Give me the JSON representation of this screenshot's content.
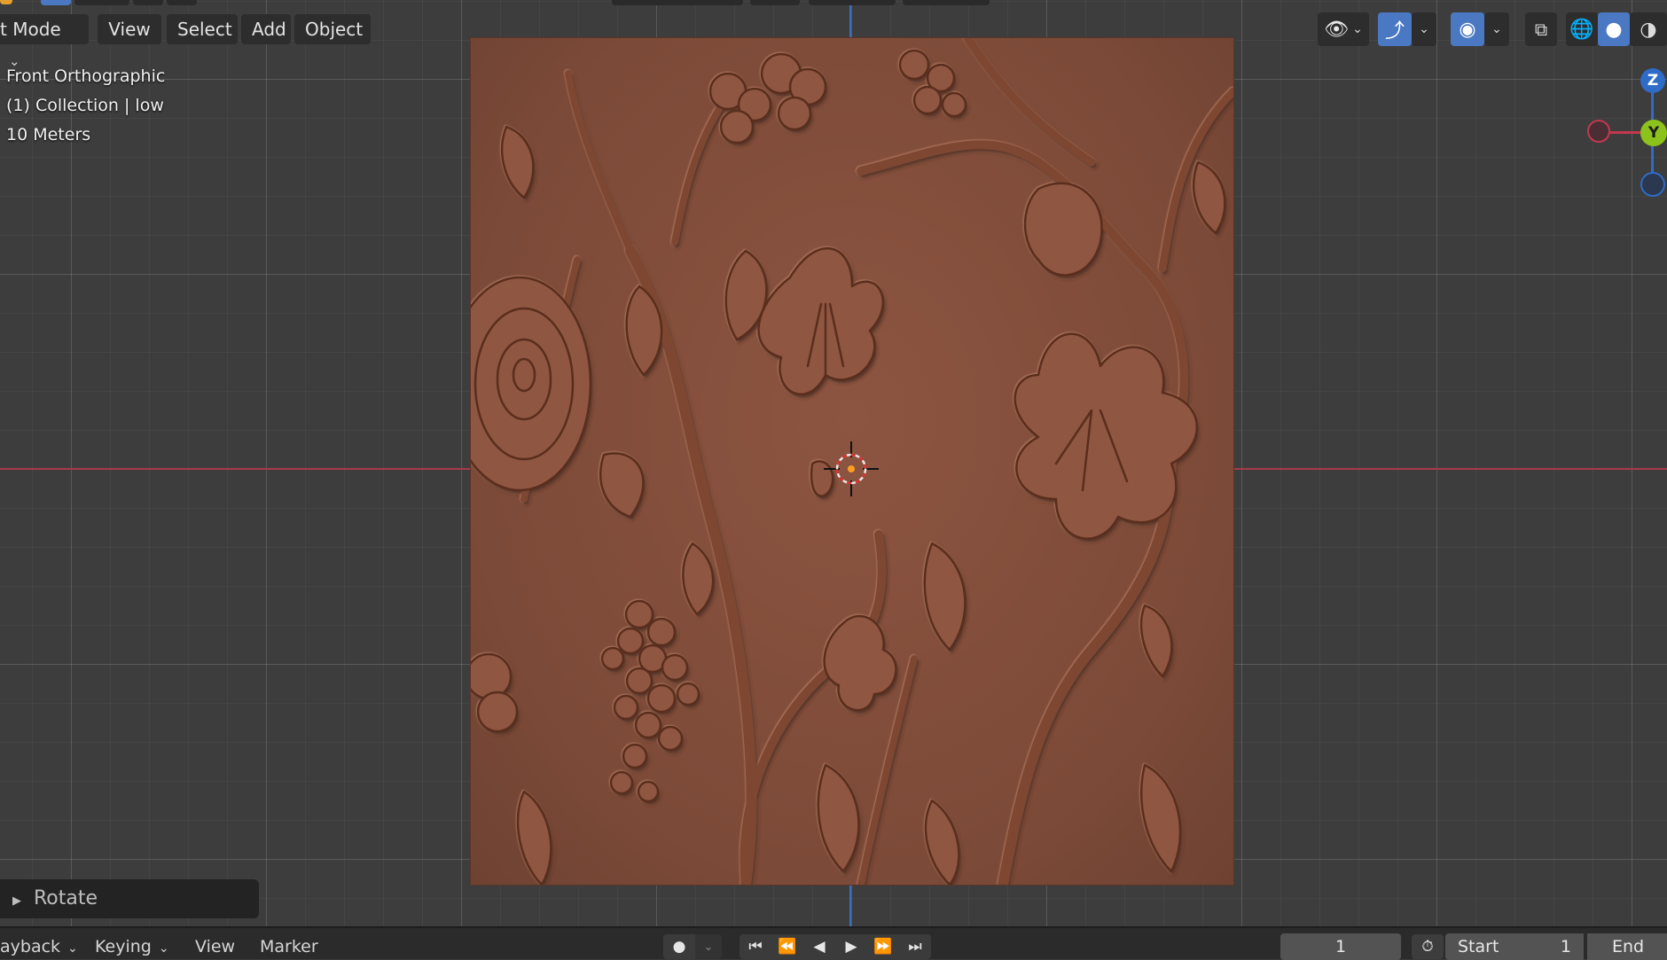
{
  "header": {
    "mode_label": "t Mode",
    "menu": [
      "View",
      "Select",
      "Add",
      "Object"
    ]
  },
  "overlay": {
    "view_name": "Front Orthographic",
    "collection": "(1) Collection | low",
    "scale": "10 Meters"
  },
  "gizmo": {
    "z_label": "Z",
    "y_label": "Y"
  },
  "operator_panel": {
    "label": "Rotate"
  },
  "timeline": {
    "menus": [
      "ayback",
      "Keying",
      "View",
      "Marker"
    ],
    "current_frame": "1",
    "start_label": "Start",
    "start_value": "1",
    "end_label": "End"
  },
  "colors": {
    "viewport_bg": "#3d3d3d",
    "relief": "#7c4a38",
    "x_axis": "#a83a48",
    "z_axis": "#3a6fc0",
    "active_blue": "#4a78c2",
    "gizmo_y": "#8cc21c",
    "gizmo_x": "#c0394f",
    "gizmo_z": "#2e6cc7"
  },
  "icons": [
    "chevron-down-icon",
    "eye-icon",
    "gizmo-icon",
    "overlay-icon",
    "xray-icon",
    "wireframe-icon",
    "solid-icon",
    "material-icon",
    "clock-icon",
    "record-icon",
    "jump-start-icon",
    "prev-keyframe-icon",
    "play-reverse-icon",
    "play-icon",
    "next-keyframe-icon",
    "jump-end-icon"
  ]
}
